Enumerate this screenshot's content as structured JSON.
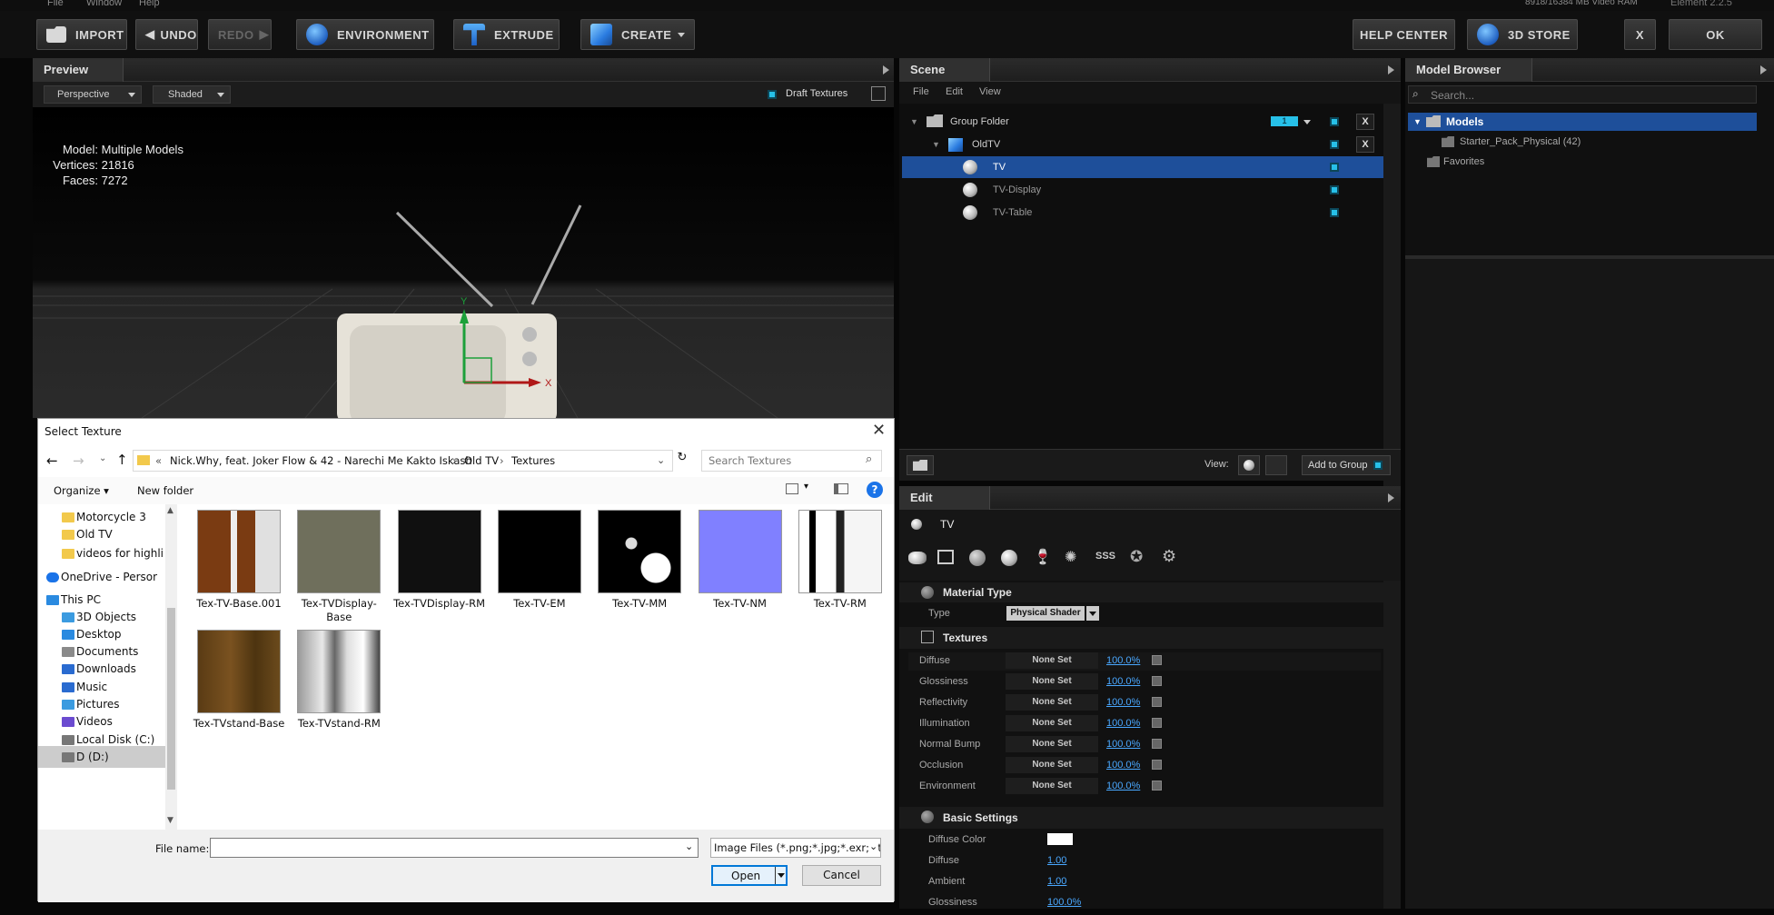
{
  "menubar": {
    "items": [
      "File",
      "Window",
      "Help"
    ],
    "ram": "8918/16384 MB Video RAM",
    "element": "Element  2.2.5"
  },
  "toolbar": {
    "import": "IMPORT",
    "undo": "UNDO",
    "redo": "REDO",
    "environment": "ENVIRONMENT",
    "extrude": "EXTRUDE",
    "create": "CREATE",
    "help_center": "HELP CENTER",
    "store": "3D STORE",
    "x": "X",
    "ok": "OK"
  },
  "preview": {
    "title": "Preview",
    "view": "Perspective",
    "shading": "Shaded",
    "draft": "Draft Textures",
    "model_label": "Model:",
    "model": "Multiple Models",
    "vertices_label": "Vertices:",
    "vertices": "21816",
    "faces_label": "Faces:",
    "faces": "7272"
  },
  "scene": {
    "title": "Scene",
    "menu": [
      "File",
      "Edit",
      "View"
    ],
    "rows": [
      {
        "label": "Group Folder",
        "badge": "1"
      },
      {
        "label": "OldTV"
      },
      {
        "label": "TV"
      },
      {
        "label": "TV-Display"
      },
      {
        "label": "TV-Table"
      }
    ],
    "view_label": "View:",
    "add_to_group": "Add to Group"
  },
  "model_browser": {
    "title": "Model Browser",
    "search_placeholder": "Search...",
    "items": [
      "Models",
      "Starter_Pack_Physical (42)",
      "Favorites"
    ]
  },
  "edit": {
    "title": "Edit",
    "object": "TV",
    "material_type": "Material Type",
    "type_label": "Type",
    "type_value": "Physical Shader",
    "textures": "Textures",
    "rows": [
      {
        "label": "Diffuse",
        "value": "None Set",
        "pct": "100.0%"
      },
      {
        "label": "Glossiness",
        "value": "None Set",
        "pct": "100.0%"
      },
      {
        "label": "Reflectivity",
        "value": "None Set",
        "pct": "100.0%"
      },
      {
        "label": "Illumination",
        "value": "None Set",
        "pct": "100.0%"
      },
      {
        "label": "Normal Bump",
        "value": "None Set",
        "pct": "100.0%"
      },
      {
        "label": "Occlusion",
        "value": "None Set",
        "pct": "100.0%"
      },
      {
        "label": "Environment",
        "value": "None Set",
        "pct": "100.0%"
      }
    ],
    "basic_settings": "Basic Settings",
    "basic": [
      {
        "label": "Diffuse Color",
        "value": ""
      },
      {
        "label": "Diffuse",
        "value": "1.00"
      },
      {
        "label": "Ambient",
        "value": "1.00"
      },
      {
        "label": "Glossiness",
        "value": "100.0%"
      }
    ]
  },
  "dialog": {
    "title": "Select Texture",
    "path": [
      "Nick.Why, feat. Joker Flow & 42 - Narechi Me Kakto Iskash",
      "Old TV",
      "Textures"
    ],
    "search_placeholder": "Search Textures",
    "organize": "Organize",
    "new_folder": "New folder",
    "nav": [
      "Motorcycle 3",
      "Old TV",
      "videos for highli",
      "OneDrive - Persor",
      "This PC",
      "3D Objects",
      "Desktop",
      "Documents",
      "Downloads",
      "Music",
      "Pictures",
      "Videos",
      "Local Disk (C:)",
      "D (D:)"
    ],
    "files": [
      "Tex-TV-Base.001",
      "Tex-TVDisplay-Base",
      "Tex-TVDisplay-RM",
      "Tex-TV-EM",
      "Tex-TV-MM",
      "Tex-TV-NM",
      "Tex-TV-RM",
      "Tex-TVstand-Base",
      "Tex-TVstand-RM"
    ],
    "file_name_label": "File name:",
    "file_name_value": "",
    "filter": "Image Files (*.png;*.jpg;*.exr;*.t",
    "open": "Open",
    "cancel": "Cancel"
  },
  "colors": {
    "accent": "#27c0e8",
    "selection": "#1e4f9a",
    "link": "#4aa8ff"
  }
}
